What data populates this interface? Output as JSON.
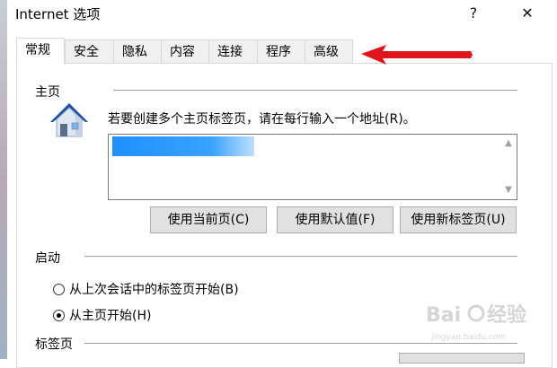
{
  "window": {
    "title": "Internet 选项",
    "help_glyph": "?",
    "close_glyph": "✕"
  },
  "tabs": [
    {
      "label": "常规",
      "active": true
    },
    {
      "label": "安全",
      "active": false
    },
    {
      "label": "隐私",
      "active": false
    },
    {
      "label": "内容",
      "active": false
    },
    {
      "label": "连接",
      "active": false
    },
    {
      "label": "程序",
      "active": false
    },
    {
      "label": "高级",
      "active": false
    }
  ],
  "homepage": {
    "section_label": "主页",
    "instruction": "若要创建多个主页标签页，请在每行输入一个地址(R)。",
    "url_value": "",
    "buttons": {
      "use_current": "使用当前页(C)",
      "use_default": "使用默认值(F)",
      "use_new_tab": "使用新标签页(U)"
    },
    "icon": "house-icon"
  },
  "startup": {
    "section_label": "启动",
    "options": [
      {
        "label": "从上次会话中的标签页开始(B)",
        "checked": false
      },
      {
        "label": "从主页开始(H)",
        "checked": true
      }
    ]
  },
  "tabs_section": {
    "section_label": "标签页"
  },
  "annotation": {
    "arrow_color": "#e0151b",
    "points_to": "tab-advanced"
  },
  "watermark": {
    "brand": "Baidu 经验",
    "sub": "jingyan.baidu.com"
  },
  "colors": {
    "accent_highlight": "#1e90ff",
    "button_bg": "#e1e1e1",
    "tab_bg": "#f0f0f0",
    "border": "#d9d9d9"
  }
}
